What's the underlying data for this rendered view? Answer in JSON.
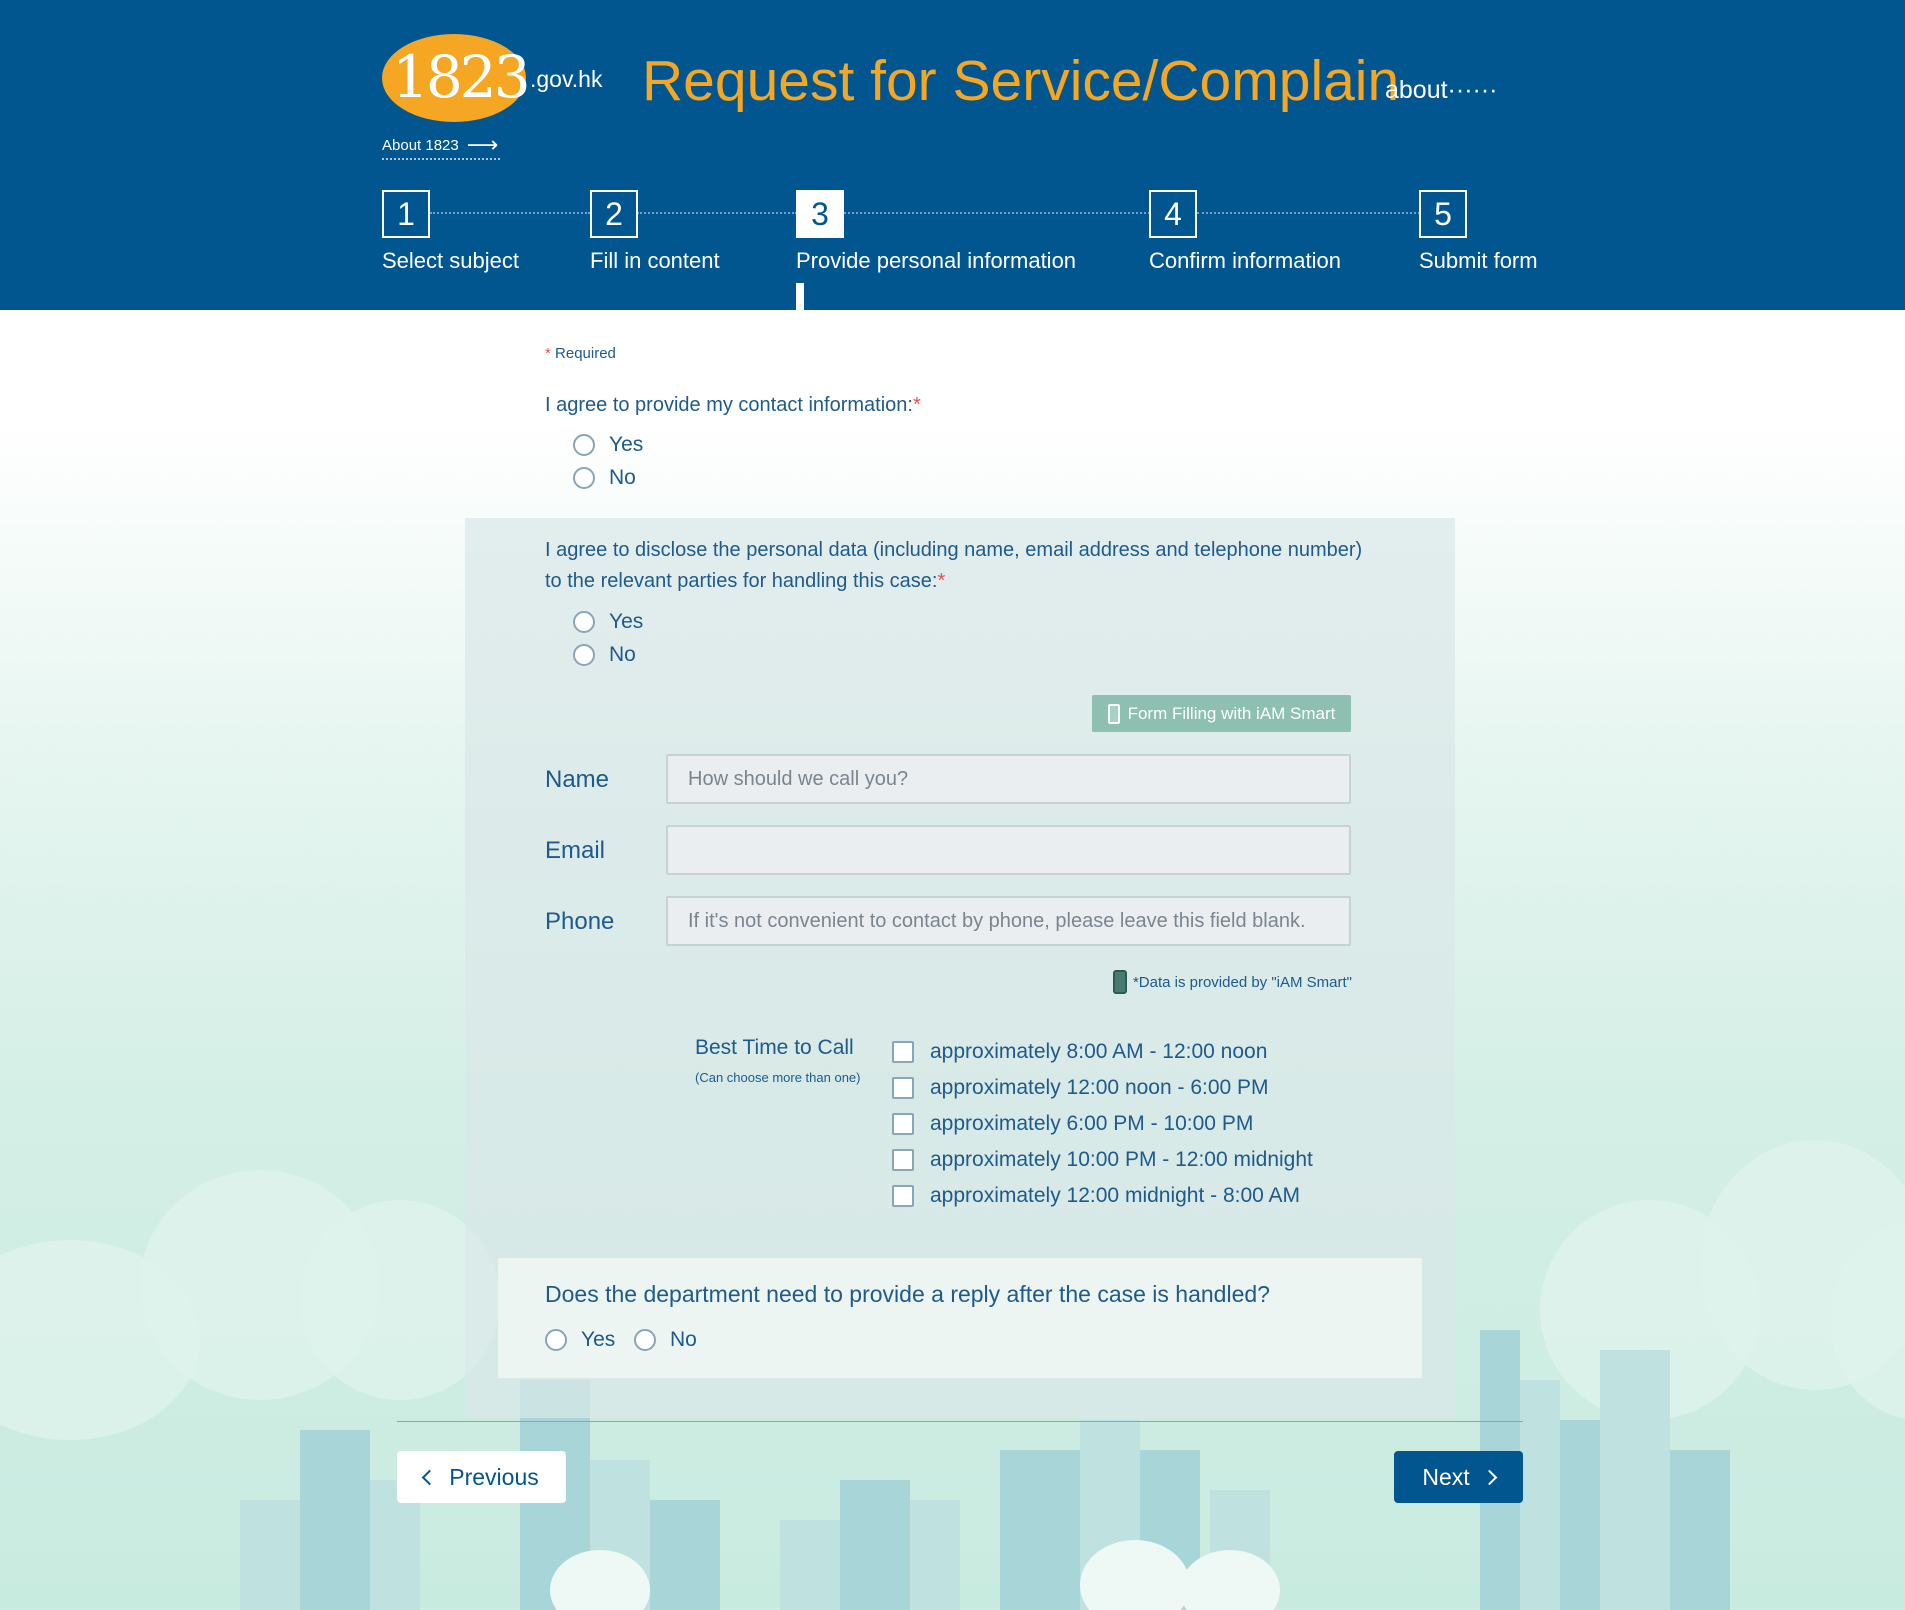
{
  "header": {
    "logo_number": "1823",
    "logo_domain": ".gov.hk",
    "about_link": "About 1823",
    "title": "Request for Service/Complain",
    "title_suffix": "about······"
  },
  "steps": [
    {
      "number": "1",
      "label": "Select subject"
    },
    {
      "number": "2",
      "label": "Fill in content"
    },
    {
      "number": "3",
      "label": "Provide personal information"
    },
    {
      "number": "4",
      "label": "Confirm information"
    },
    {
      "number": "5",
      "label": "Submit form"
    }
  ],
  "active_step": 3,
  "form": {
    "required_marker": "*",
    "required_note": "Required",
    "q_contact": "I agree to provide my contact information:",
    "q_disclose_line1": "I agree to disclose the personal data (including name, email address and telephone number)",
    "q_disclose_line2": "to the relevant parties for handling this case:",
    "yes": "Yes",
    "no": "No",
    "iam_button": "Form Filling with iAM Smart",
    "name_label": "Name",
    "name_placeholder": "How should we call you?",
    "email_label": "Email",
    "email_placeholder": "",
    "phone_label": "Phone",
    "phone_placeholder": "If it's not convenient to contact by phone, please leave this field blank.",
    "data_note": "*Data is provided by \"iAM Smart\"",
    "best_time_label": "Best Time to Call",
    "best_time_sub": "(Can choose more than one)",
    "time_options": [
      "approximately 8:00 AM - 12:00 noon",
      "approximately 12:00 noon - 6:00 PM",
      "approximately 6:00 PM - 10:00 PM",
      "approximately 10:00 PM - 12:00 midnight",
      "approximately 12:00 midnight - 8:00 AM"
    ],
    "reply_question": "Does the department need to provide a reply after the case is handled?"
  },
  "nav": {
    "previous": "Previous",
    "next": "Next"
  },
  "colors": {
    "header_bg": "#02568f",
    "accent": "#f5a623",
    "text": "#1e5a8a",
    "required": "#e85050",
    "iam_button": "#8dc0b0"
  }
}
